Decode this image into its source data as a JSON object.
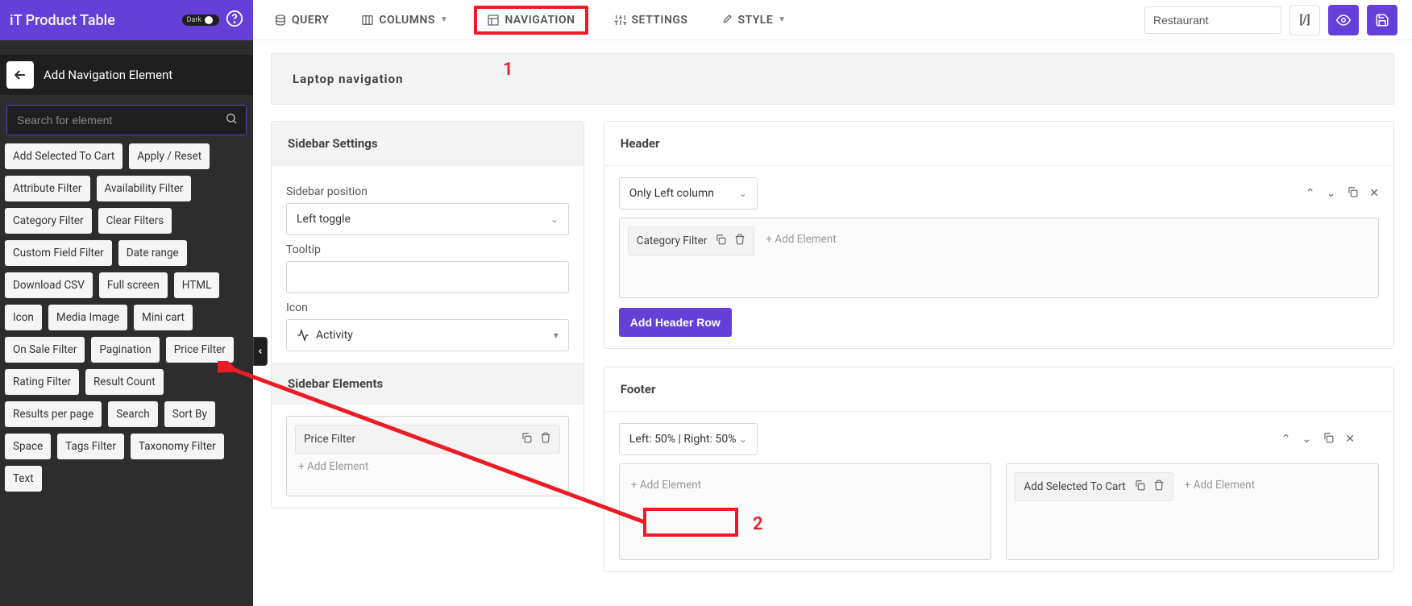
{
  "sidebar": {
    "title": "iT Product Table",
    "dark_label": "Dark",
    "sub_title": "Add Navigation Element",
    "search_placeholder": "Search for element",
    "chips": [
      "Add Selected To Cart",
      "Apply / Reset",
      "Attribute Filter",
      "Availability Filter",
      "Category Filter",
      "Clear Filters",
      "Custom Field Filter",
      "Date range",
      "Download CSV",
      "Full screen",
      "HTML",
      "Icon",
      "Media Image",
      "Mini cart",
      "On Sale Filter",
      "Pagination",
      "Price Filter",
      "Rating Filter",
      "Result Count",
      "Results per page",
      "Search",
      "Sort By",
      "Space",
      "Tags Filter",
      "Taxonomy Filter",
      "Text"
    ]
  },
  "topbar": {
    "tabs": [
      "QUERY",
      "COLUMNS",
      "NAVIGATION",
      "SETTINGS",
      "STYLE"
    ],
    "tenant": "Restaurant",
    "shortcode_label": "[/]"
  },
  "page": {
    "title": "Laptop navigation",
    "sidebar_settings": {
      "heading": "Sidebar Settings",
      "position_label": "Sidebar position",
      "position_value": "Left toggle",
      "tooltip_label": "Tooltip",
      "tooltip_value": "",
      "icon_label": "Icon",
      "icon_value": "Activity"
    },
    "sidebar_elements": {
      "heading": "Sidebar Elements",
      "chip": "Price Filter",
      "add": "+ Add Element"
    },
    "header": {
      "heading": "Header",
      "row_select": "Only Left column",
      "chip": "Category Filter",
      "add": "+ Add Element",
      "add_row": "Add Header Row"
    },
    "footer": {
      "heading": "Footer",
      "row_select": "Left: 50% | Right: 50%",
      "add_left": "+ Add Element",
      "right_chip": "Add Selected To Cart",
      "add_right": "+ Add Element"
    }
  },
  "callouts": {
    "one": "1",
    "two": "2"
  }
}
